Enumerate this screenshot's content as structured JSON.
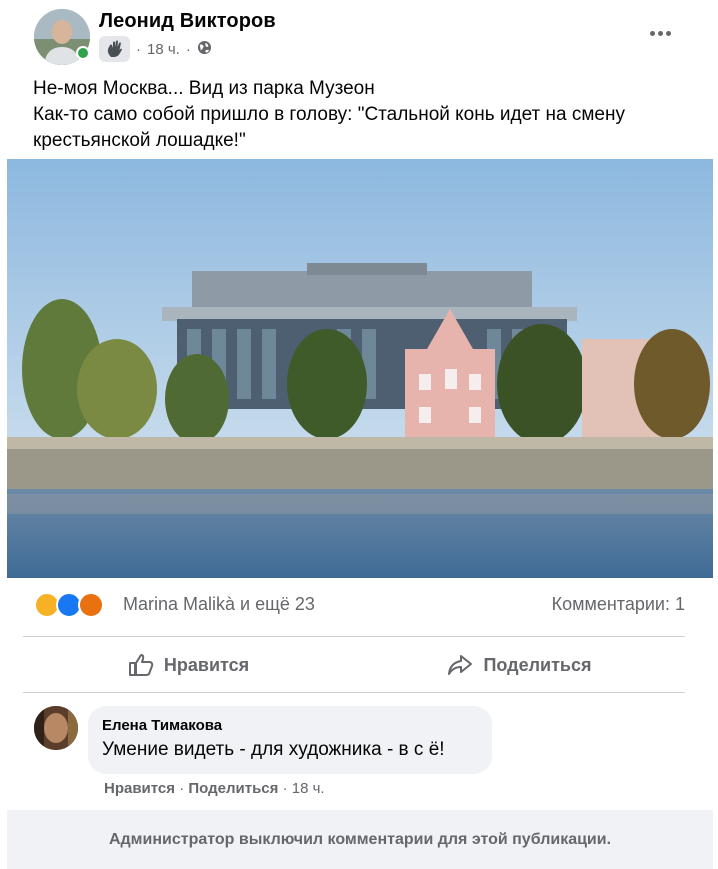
{
  "post": {
    "author": "Леонид Викторов",
    "time": "18 ч.",
    "text_lines": [
      "Не-моя Москва... Вид из парка Музеон",
      "Как-то само собой пришло в голову: \"Стальной конь идет на смену",
      "крестьянской лошадке!\""
    ]
  },
  "reactions": {
    "icons": [
      "sad-reaction",
      "like-reaction",
      "angry-reaction"
    ],
    "names": "Marina Malikà и ещё 23",
    "comments_count": "Комментарии: 1"
  },
  "actions": {
    "like_label": "Нравится",
    "share_label": "Поделиться"
  },
  "comment": {
    "author": "Елена Тимакова",
    "text": "Умение видеть - для художника - в с ё!",
    "like_label": "Нравится",
    "separator": " · ",
    "share_label": "Поделиться",
    "time": "18 ч."
  },
  "footer_notice": "Администратор выключил комментарии для этой публикации.",
  "colors": {
    "accent": "#1877f2",
    "secondary_text": "#65676b",
    "bubble_bg": "#f0f2f5",
    "online": "#31a24c"
  }
}
